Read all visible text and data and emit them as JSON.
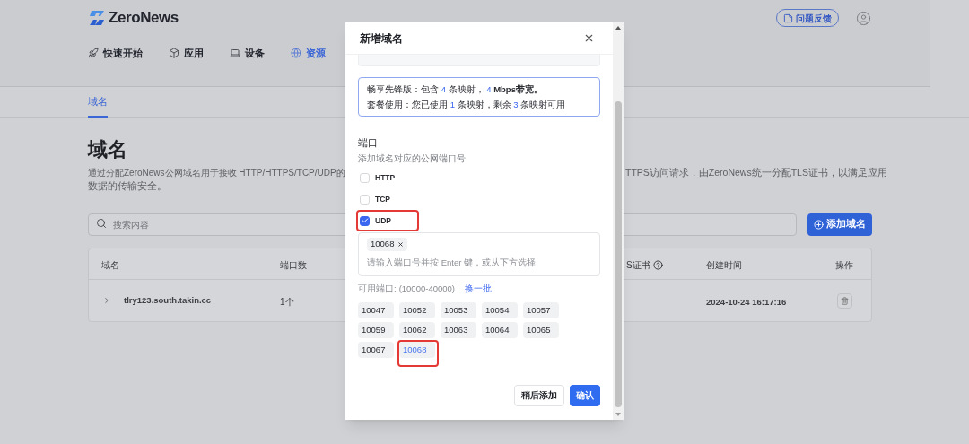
{
  "header": {
    "logo": "ZeroNews",
    "nav": [
      {
        "label": "快速开始",
        "selected": false
      },
      {
        "label": "应用",
        "selected": false
      },
      {
        "label": "设备",
        "selected": false
      },
      {
        "label": "资源",
        "selected": true
      }
    ],
    "feedback": "问题反馈"
  },
  "subnav": [
    {
      "label": "域名",
      "selected": true
    }
  ],
  "page": {
    "title": "域名",
    "description_left": "通过分配ZeroNews公网域名用于接收 HTTP/HTTPS/TCP/UDP的",
    "description_right": "TTPS访问请求，由ZeroNews统一分配TLS证书，以满足应用",
    "description_line2": "数据的传输安全。"
  },
  "search": {
    "placeholder": "搜索内容"
  },
  "add_button": "添加域名",
  "table": {
    "columns": [
      {
        "label": "域名",
        "help": false
      },
      {
        "label": "端口数",
        "help": false
      },
      {
        "label": "S证书",
        "help": true
      },
      {
        "label": "创建时间",
        "help": false
      },
      {
        "label": "操作",
        "help": false
      }
    ],
    "rows": [
      {
        "domain": "tlry123.south.takin.cc",
        "ports": "1个",
        "created": "2024-10-24 16:17:16",
        "expanded": false
      }
    ]
  },
  "dialog": {
    "title": "新增域名",
    "plan": [
      [
        {
          "text": "畅享先锋版：包含 ",
          "accent": false,
          "bold": false
        },
        {
          "text": "4",
          "accent": true,
          "bold": false
        },
        {
          "text": " 条映射， ",
          "accent": false,
          "bold": false
        },
        {
          "text": "4",
          "accent": true,
          "bold": false
        },
        {
          "text": " Mbps带宽。",
          "accent": false,
          "bold": true
        }
      ],
      [
        {
          "text": "套餐使用：您已使用 ",
          "accent": false,
          "bold": false
        },
        {
          "text": "1",
          "accent": true,
          "bold": false
        },
        {
          "text": " 条映射，剩余 ",
          "accent": false,
          "bold": false
        },
        {
          "text": "3",
          "accent": true,
          "bold": false
        },
        {
          "text": " 条映射可用",
          "accent": false,
          "bold": false
        }
      ]
    ],
    "port_label": "端口",
    "port_hint": "添加域名对应的公网端口号",
    "protocols": [
      {
        "label": "HTTP",
        "checked": false,
        "highlighted": false
      },
      {
        "label": "TCP",
        "checked": false,
        "highlighted": false
      },
      {
        "label": "UDP",
        "checked": true,
        "highlighted": true
      }
    ],
    "tags": [
      "10068"
    ],
    "tag_placeholder": "请输入端口号并按 Enter 键，或从下方选择",
    "available_label": "可用端口:",
    "available_range": "(10000-40000)",
    "refresh": "换一批",
    "ports": [
      {
        "label": "10047",
        "selected": false,
        "highlighted": false
      },
      {
        "label": "10052",
        "selected": false,
        "highlighted": false
      },
      {
        "label": "10053",
        "selected": false,
        "highlighted": false
      },
      {
        "label": "10054",
        "selected": false,
        "highlighted": false
      },
      {
        "label": "10057",
        "selected": false,
        "highlighted": false
      },
      {
        "label": "10059",
        "selected": false,
        "highlighted": false
      },
      {
        "label": "10062",
        "selected": false,
        "highlighted": false
      },
      {
        "label": "10063",
        "selected": false,
        "highlighted": false
      },
      {
        "label": "10064",
        "selected": false,
        "highlighted": false
      },
      {
        "label": "10065",
        "selected": false,
        "highlighted": false
      },
      {
        "label": "10067",
        "selected": false,
        "highlighted": false
      },
      {
        "label": "10068",
        "selected": true,
        "highlighted": true
      }
    ],
    "buttons": [
      {
        "label": "稍后添加",
        "kind": "secondary"
      },
      {
        "label": "确认",
        "kind": "primary"
      }
    ]
  }
}
